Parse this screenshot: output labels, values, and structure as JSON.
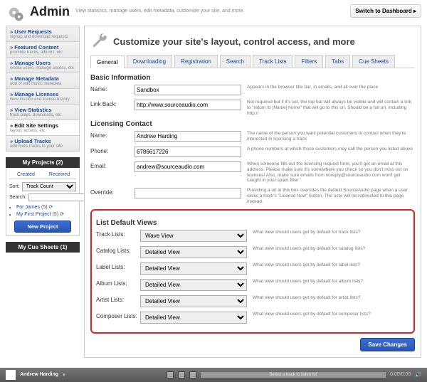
{
  "header": {
    "title": "Admin",
    "tagline": "View statistics, manage users, edit metadata, customize your site, and more.",
    "dashboard_btn": "Switch to Dashboard ▸"
  },
  "sidebar": {
    "items": [
      {
        "label": "» User Requests",
        "sub": "signup and download requests"
      },
      {
        "label": "» Featured Content",
        "sub": "promote tracks, albums, etc"
      },
      {
        "label": "» Manage Users",
        "sub": "create users, manage access, etc"
      },
      {
        "label": "» Manage Metadata",
        "sub": "add or edit music metadata"
      },
      {
        "label": "» Manage Licenses",
        "sub": "view invoice and license history"
      },
      {
        "label": "» View Statistics",
        "sub": "track plays, downloads, etc"
      },
      {
        "label": "» Edit Site Settings",
        "sub": "layout, access, etc"
      },
      {
        "label": "» Upload Tracks",
        "sub": "add more tracks to your site"
      }
    ],
    "projects": {
      "title": "My Projects (2)",
      "tabs": {
        "created": "Created",
        "received": "Received"
      },
      "sort_label": "Sort:",
      "sort_value": "Track Count",
      "search_label": "Search:",
      "items": [
        {
          "name": "For James",
          "count": "(5)"
        },
        {
          "name": "My First Project",
          "count": "(5)"
        }
      ],
      "new_btn": "New Project"
    },
    "cue": {
      "title": "My Cue Sheets (1)"
    }
  },
  "main": {
    "heading": "Customize your site's layout, control access, and more",
    "tabs": [
      "General",
      "Downloading",
      "Registration",
      "Search",
      "Track Lists",
      "Filters",
      "Tabs",
      "Cue Sheets"
    ],
    "basic": {
      "title": "Basic Information",
      "name": {
        "label": "Name:",
        "value": "Sandbox",
        "help": "Appears in the browser title bar, in emails, and all over the place"
      },
      "linkback": {
        "label": "Link Back:",
        "value": "http://www.sourceaudio.com",
        "help": "Not required but if it's set, the top bar will always be visible and will contain a link to \"return to [Name] home\" that will go to this url. Should be a full url, including http://"
      }
    },
    "licensing": {
      "title": "Licensing Contact",
      "name": {
        "label": "Name:",
        "value": "Andrew Harding",
        "help": "The name of the person you want potential customers to contact when they're interested in licensing a track"
      },
      "phone": {
        "label": "Phone:",
        "value": "6786617226",
        "help": "A phone numbers at which those customers may call the person you listed above"
      },
      "email": {
        "label": "Email:",
        "value": "andrew@sourceaudio.com",
        "help": "When someone fills out the licensing request form, you'll get an email at this address. Please make sure it's somewhere you check so you don't miss out on licenses! Also, make sure emails from noreply@sourceaudio.com won't get caught in your spam filter"
      },
      "override": {
        "label": "Override:",
        "value": "",
        "help": "Providing a url in this box overrides the default SourceAudio page when a user clicks a track's \"License Now\" button. The user will be redirected to this page instead."
      }
    },
    "defaults": {
      "title": "List Default Views",
      "rows": [
        {
          "label": "Track Lists:",
          "value": "Wave View",
          "help": "What view should users get by default for track lists?"
        },
        {
          "label": "Catalog Lists:",
          "value": "Detailed View",
          "help": "What view should users get by default for catalog lists?"
        },
        {
          "label": "Label Lists:",
          "value": "Detailed View",
          "help": "What view should users get by default for label lists?"
        },
        {
          "label": "Album Lists:",
          "value": "Detailed View",
          "help": "What view should users get by default for album lists?"
        },
        {
          "label": "Artist Lists:",
          "value": "Detailed View",
          "help": "What view should users get by default for artist lists?"
        },
        {
          "label": "Composer Lists:",
          "value": "Detailed View",
          "help": "What view should users get by default for composer lists?"
        }
      ]
    },
    "save": "Save Changes"
  },
  "player": {
    "user": "Andrew Harding",
    "placeholder": "Select a track to listen to!",
    "time": "0:00/0:00"
  }
}
